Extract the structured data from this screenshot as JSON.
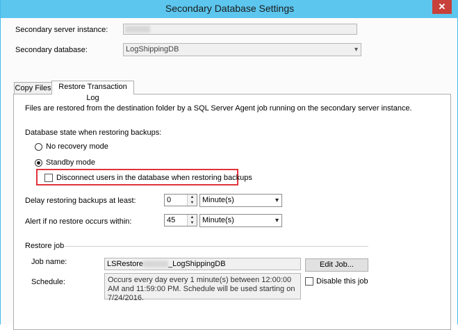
{
  "window": {
    "title": "Secondary Database Settings",
    "close_glyph": "✕"
  },
  "server_instance": {
    "label": "Secondary server instance:",
    "value": ""
  },
  "secondary_db": {
    "label": "Secondary database:",
    "value": "LogShippingDB"
  },
  "tabs": [
    {
      "label": "Copy Files"
    },
    {
      "label": "Restore Transaction Log"
    }
  ],
  "restore": {
    "description": "Files are restored from the destination folder by a SQL Server Agent job running on the secondary server instance.",
    "state_label": "Database state when restoring backups:",
    "no_recovery_label": "No recovery mode",
    "standby_label": "Standby mode",
    "selected_mode": "standby",
    "disconnect_label": "Disconnect users in the database when restoring backups",
    "disconnect_checked": false,
    "delay_label": "Delay restoring backups at least:",
    "delay_value": "0",
    "delay_unit": "Minute(s)",
    "alert_label": "Alert if no restore occurs within:",
    "alert_value": "45",
    "alert_unit": "Minute(s)"
  },
  "restore_job": {
    "section_label": "Restore job",
    "job_name_label": "Job name:",
    "job_name_prefix": "LSRestore",
    "job_name_suffix": "_LogShippingDB",
    "edit_job_label": "Edit Job...",
    "schedule_label": "Schedule:",
    "schedule_text": "Occurs every day every 1 minute(s) between 12:00:00 AM and 11:59:00 PM. Schedule will be used starting on 7/24/2016.",
    "disable_label": "Disable this job",
    "disable_checked": false
  },
  "colors": {
    "titlebar": "#5cc6ee",
    "highlight": "#e0333a",
    "close": "#c7403a"
  }
}
